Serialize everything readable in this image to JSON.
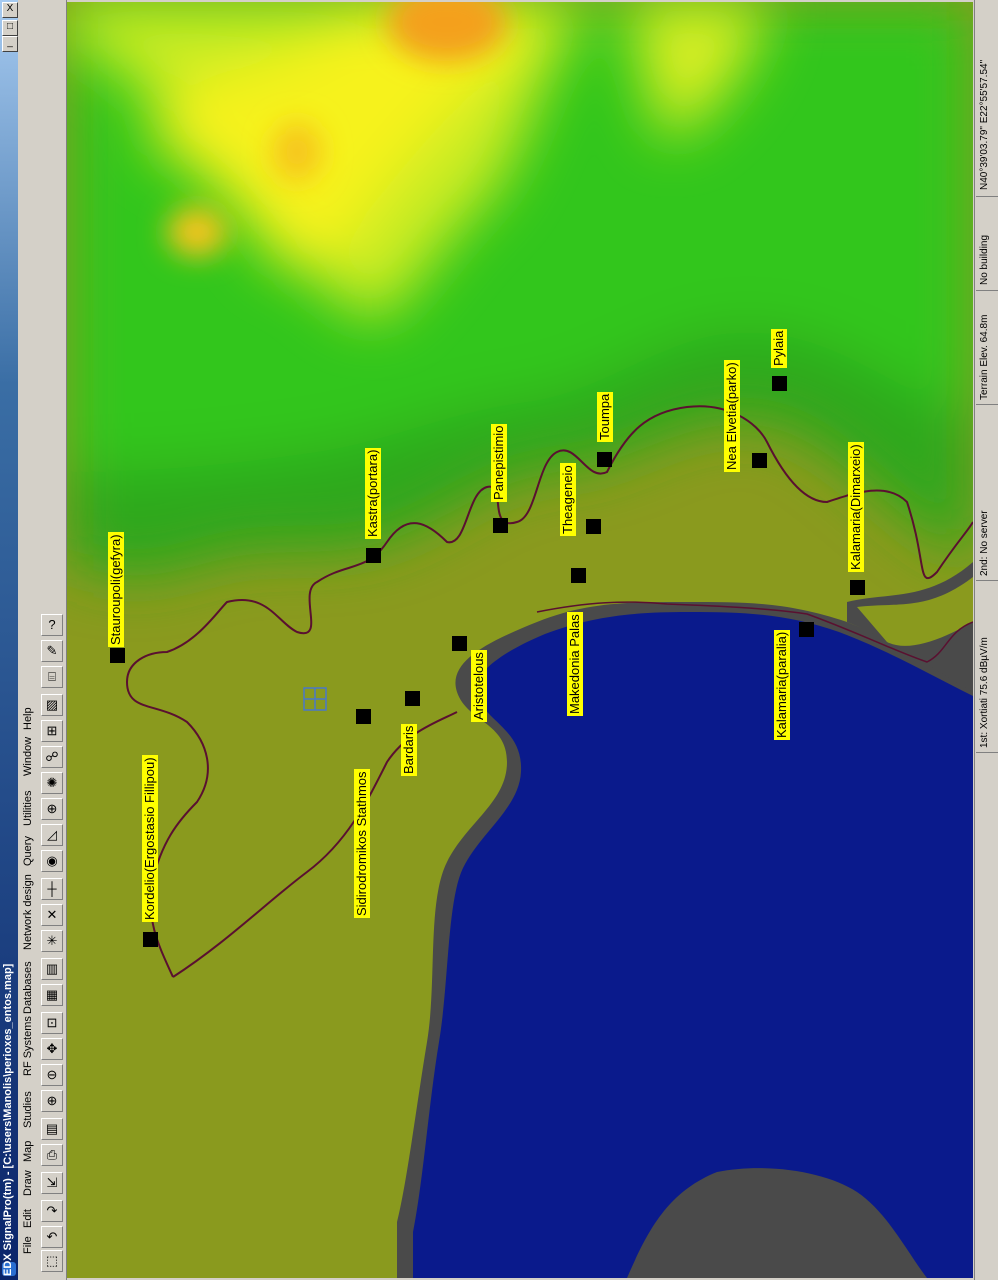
{
  "window": {
    "title": "EDX SignalPro(tm) - [C:\\users\\Manolis\\perioxes_entos.map]",
    "minimize": "_",
    "maximize": "□",
    "close": "X"
  },
  "menu": [
    "File",
    "Edit",
    "Draw",
    "Map",
    "Studies",
    "RF Systems",
    "Databases",
    "Network design",
    "Query",
    "Utilities",
    "Window",
    "Help"
  ],
  "status": {
    "coords": "N40°39'03.79\" E22°55'57.54\"",
    "building": "No building",
    "terrain": "Terrain Elev. 64.8m",
    "second": "2nd:  No server",
    "first": "1st:  Xortiati  75.6 dBµV/m"
  },
  "sites": [
    {
      "label": "Stauroupoli(gefyra)"
    },
    {
      "label": "Kastra(portara)"
    },
    {
      "label": "Panepistimio"
    },
    {
      "label": "Theageneio"
    },
    {
      "label": "Toumpa"
    },
    {
      "label": "Nea Elvetia(parko)"
    },
    {
      "label": "Pylaia"
    },
    {
      "label": "Kalamaria(Dimarxeio)"
    },
    {
      "label": "Kordelio(Ergostasio Fillipou)"
    },
    {
      "label": "Sidirodromikos Stathmos"
    },
    {
      "label": "Bardaris"
    },
    {
      "label": "Aristotelous"
    },
    {
      "label": "Makedonia Palas"
    },
    {
      "label": "Kalamaria(paralia)"
    }
  ],
  "colors": {
    "sea": "#0a1a8c",
    "coast": "#4a4a4a",
    "lowland": "#8a9a1e",
    "hills": "#1fae1f",
    "peaks": "#f6f21a",
    "summit": "#f4a01a",
    "boundary": "#5a1030",
    "label_bg": "#ffff00"
  }
}
